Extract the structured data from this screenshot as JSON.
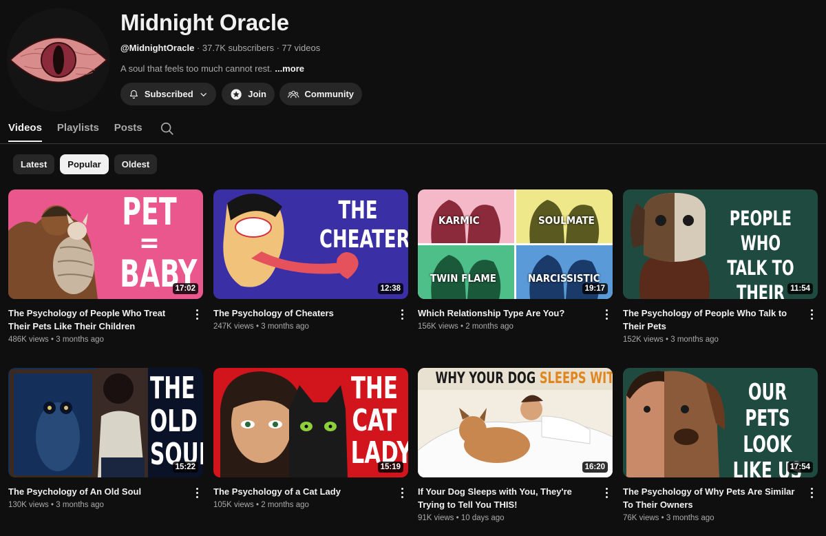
{
  "channel": {
    "name": "Midnight Oracle",
    "handle": "@MidnightOracle",
    "subscribers": "37.7K subscribers",
    "videos_count": "77 videos",
    "separator": "·",
    "description": "A soul that feels too much cannot rest.",
    "more_label": "...more"
  },
  "actions": {
    "subscribed_label": "Subscribed",
    "join_label": "Join",
    "community_label": "Community"
  },
  "tabs": [
    {
      "label": "Videos",
      "active": true
    },
    {
      "label": "Playlists",
      "active": false
    },
    {
      "label": "Posts",
      "active": false
    }
  ],
  "filters": [
    {
      "label": "Latest",
      "selected": false
    },
    {
      "label": "Popular",
      "selected": true
    },
    {
      "label": "Oldest",
      "selected": false
    }
  ],
  "videos": [
    {
      "title": "The Psychology of People Who Treat Their Pets Like Their Children",
      "views": "486K views",
      "age": "3 months ago",
      "duration": "17:02",
      "thumb_text": [
        "PET",
        "=",
        "BABY"
      ],
      "thumb_bg": "#e9578c"
    },
    {
      "title": "The Psychology of Cheaters",
      "views": "247K views",
      "age": "3 months ago",
      "duration": "12:38",
      "thumb_text": [
        "THE",
        "CHEATER"
      ],
      "thumb_bg": "#3b2fa6"
    },
    {
      "title": "Which Relationship Type Are You?",
      "views": "156K views",
      "age": "2 months ago",
      "duration": "19:17",
      "thumb_text": [
        "KARMIC",
        "SOULMATE",
        "TWIN FLAME",
        "NARCISSISTIC"
      ],
      "thumb_bg": "#f4e3e9"
    },
    {
      "title": "The Psychology of People Who Talk to Their Pets",
      "views": "152K views",
      "age": "3 months ago",
      "duration": "11:54",
      "thumb_text": [
        "PEOPLE WHO",
        "TALK TO",
        "THEIR PETS"
      ],
      "thumb_bg": "#1f4a3f"
    },
    {
      "title": "The Psychology of An Old Soul",
      "views": "130K views",
      "age": "3 months ago",
      "duration": "15:22",
      "thumb_text": [
        "THE",
        "OLD",
        "SOUL"
      ],
      "thumb_bg": "#0d1b3a"
    },
    {
      "title": "The Psychology of a Cat Lady",
      "views": "105K views",
      "age": "2 months ago",
      "duration": "15:19",
      "thumb_text": [
        "THE",
        "CAT",
        "LADY"
      ],
      "thumb_bg": "#d2141c"
    },
    {
      "title": "If Your Dog Sleeps with You, They're Trying to Tell You THIS!",
      "views": "91K views",
      "age": "10 days ago",
      "duration": "16:20",
      "thumb_text": [
        "WHY YOUR DOG",
        "SLEEPS WITH YOU"
      ],
      "thumb_bg": "#f3ece0"
    },
    {
      "title": "The Psychology of Why Pets Are Similar To Their Owners",
      "views": "76K views",
      "age": "3 months ago",
      "duration": "17:54",
      "thumb_text": [
        "OUR PETS",
        "LOOK",
        "LIKE US"
      ],
      "thumb_bg": "#1f4a3f"
    }
  ]
}
